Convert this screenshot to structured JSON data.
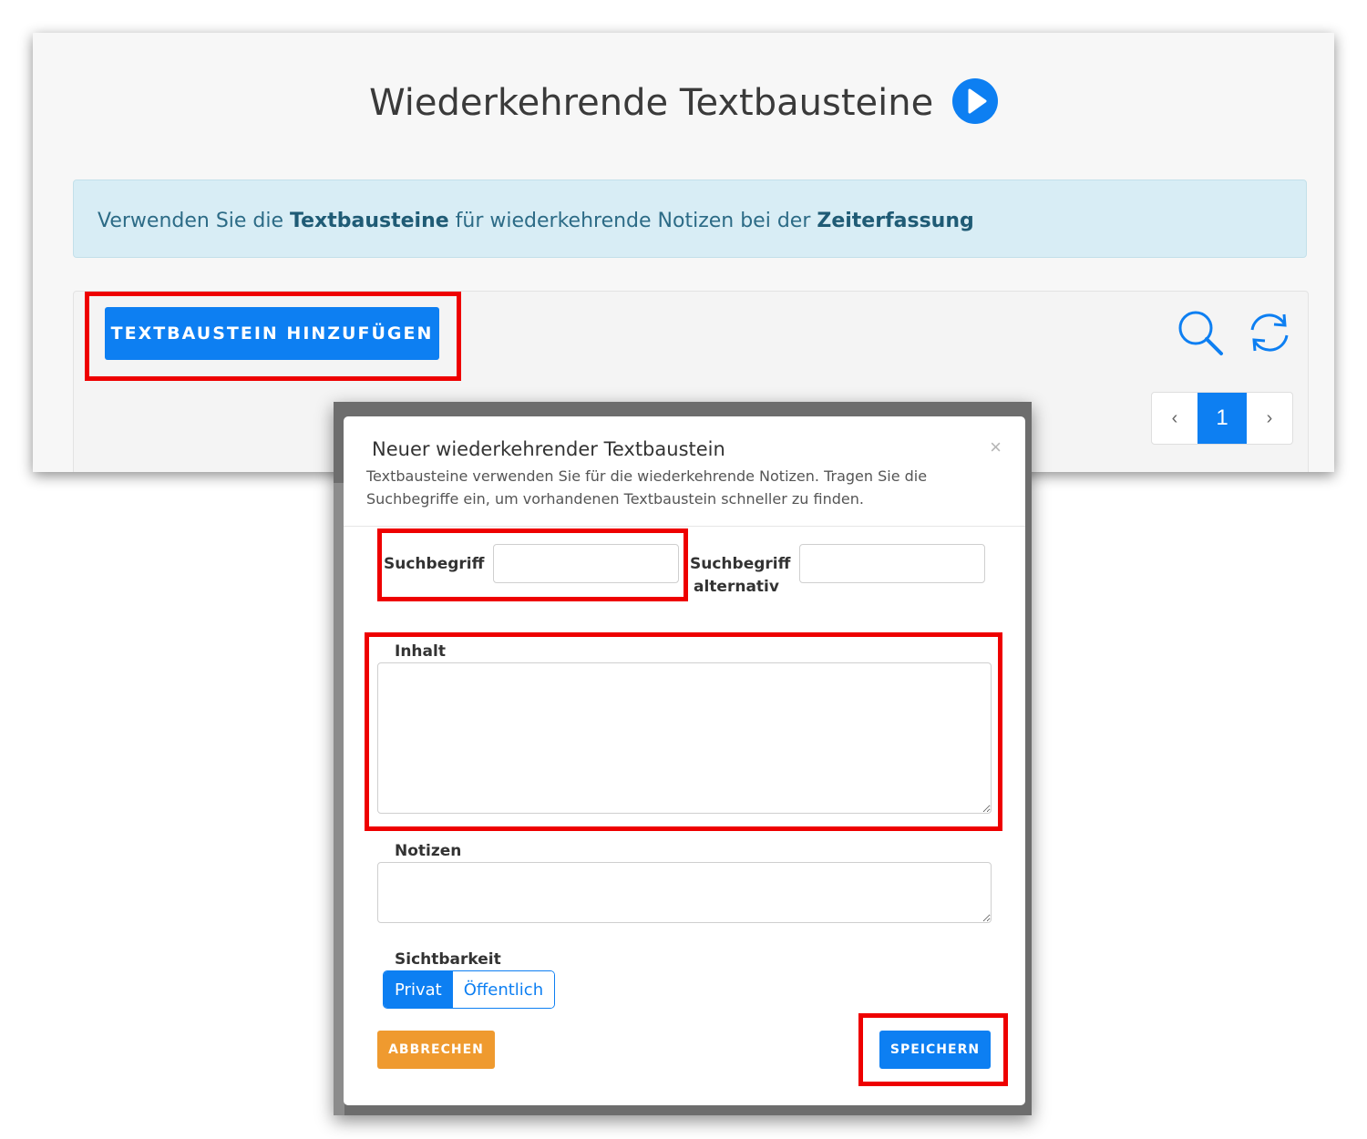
{
  "page": {
    "title": "Wiederkehrende Textbausteine",
    "info": {
      "prefix": "Verwenden Sie die ",
      "bold1": "Textbausteine",
      "middle": " für wiederkehrende Notizen bei der ",
      "bold2": "Zeiterfassung"
    },
    "add_button_label": "TEXTBAUSTEIN HINZUFÜGEN",
    "pagination": {
      "prev": "‹",
      "current": "1",
      "next": "›"
    }
  },
  "modal": {
    "title": "Neuer wiederkehrender Textbaustein",
    "close": "×",
    "description": "Textbausteine verwenden Sie für die wiederkehrende Notizen. Tragen Sie die Suchbegriffe ein, um vorhandenen Textbaustein schneller zu finden.",
    "search_label": "Suchbegriff",
    "search_value": "",
    "alt_search_label_line1": "Suchbegriff",
    "alt_search_label_line2": "alternativ",
    "alt_search_value": "",
    "content_label": "Inhalt",
    "content_value": "",
    "notes_label": "Notizen",
    "notes_value": "",
    "visibility_label": "Sichtbarkeit",
    "visibility_options": [
      "Privat",
      "Öffentlich"
    ],
    "visibility_selected": "Privat",
    "cancel_label": "ABBRECHEN",
    "save_label": "SPEICHERN"
  },
  "colors": {
    "primary": "#0d7ff2",
    "cancel": "#ef9a2f",
    "highlight": "#ee0000",
    "info_bg": "#d8edf5"
  },
  "icons": [
    "play-icon",
    "search-icon",
    "refresh-icon",
    "close-icon"
  ]
}
